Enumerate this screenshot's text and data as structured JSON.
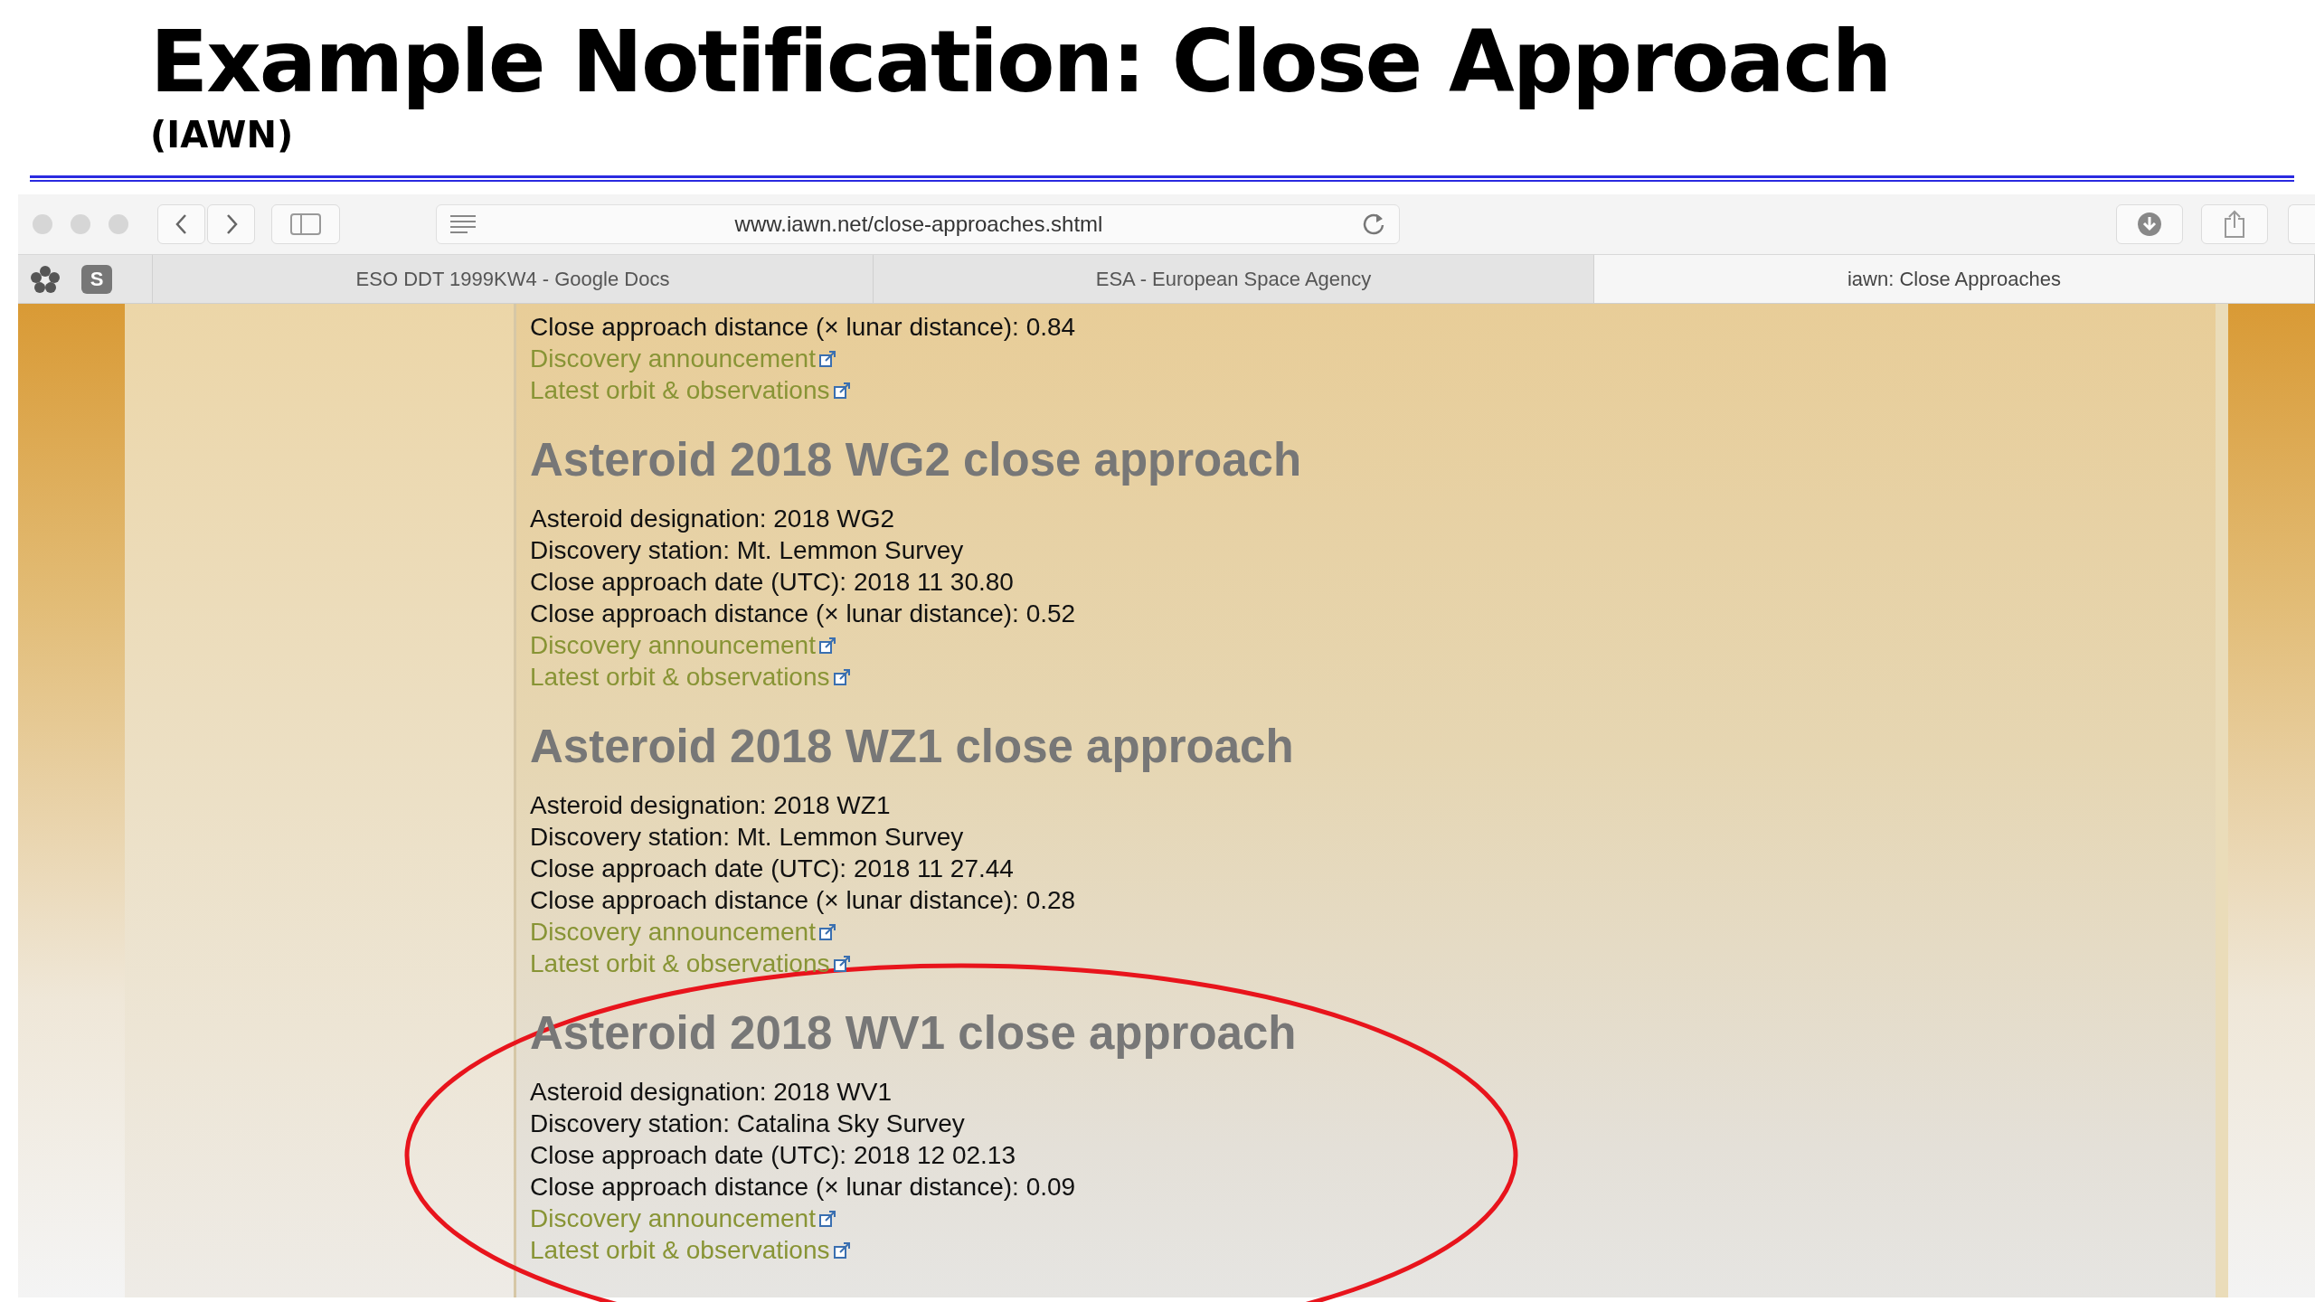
{
  "slide": {
    "title": "Example Notification:  Close Approach",
    "subtitle": "(IAWN)"
  },
  "browser": {
    "url": "www.iawn.net/close-approaches.shtml",
    "tabs": [
      {
        "label": "ESO DDT 1999KW4 - Google Docs",
        "selected": false
      },
      {
        "label": "ESA - European Space Agency",
        "selected": false
      },
      {
        "label": "iawn: Close Approaches",
        "selected": true
      }
    ],
    "sidebar_badge": "S"
  },
  "sections": [
    {
      "lines": [
        "Close approach distance (× lunar distance): 0.84"
      ],
      "links": [
        "Discovery announcement",
        "Latest orbit & observations"
      ]
    },
    {
      "heading": "Asteroid 2018 WG2 close approach",
      "lines": [
        "Asteroid designation: 2018 WG2",
        "Discovery station: Mt. Lemmon Survey",
        "Close approach date (UTC): 2018 11 30.80",
        "Close approach distance (× lunar distance): 0.52"
      ],
      "links": [
        "Discovery announcement",
        "Latest orbit & observations"
      ]
    },
    {
      "heading": "Asteroid 2018 WZ1 close approach",
      "lines": [
        "Asteroid designation: 2018 WZ1",
        "Discovery station: Mt. Lemmon Survey",
        "Close approach date (UTC): 2018 11 27.44",
        "Close approach distance (× lunar distance): 0.28"
      ],
      "links": [
        "Discovery announcement",
        "Latest orbit & observations"
      ]
    },
    {
      "heading": "Asteroid 2018 WV1 close approach",
      "lines": [
        "Asteroid designation: 2018 WV1",
        "Discovery station: Catalina Sky Survey",
        "Close approach date (UTC): 2018 12 02.13",
        "Close approach distance (× lunar distance): 0.09"
      ],
      "links": [
        "Discovery announcement",
        "Latest orbit & observations"
      ]
    }
  ]
}
